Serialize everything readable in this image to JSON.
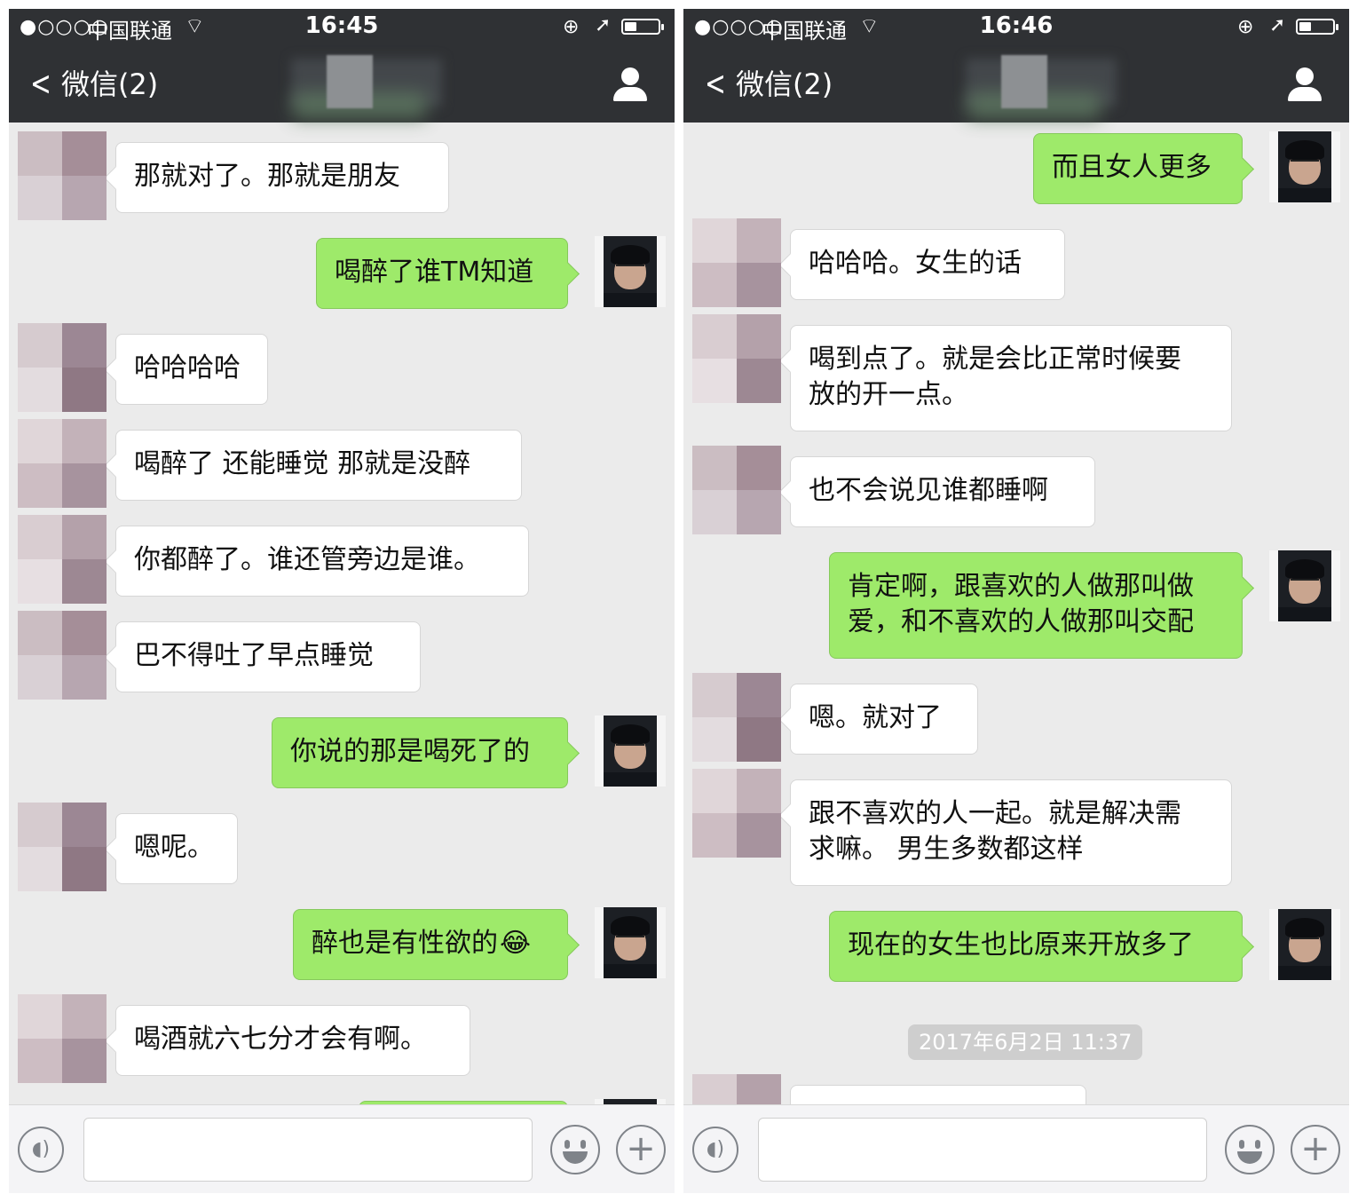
{
  "screens": [
    {
      "status": {
        "signal": "●○○○○",
        "carrier": "中国联通",
        "time": "16:45"
      },
      "nav": {
        "back_label": "微信(2)"
      },
      "timestamp": "",
      "messages": [
        {
          "from": "other",
          "text": "那就对了。那就是朋友"
        },
        {
          "from": "me",
          "text": "喝醉了谁TM知道"
        },
        {
          "from": "other",
          "text": "哈哈哈哈"
        },
        {
          "from": "other",
          "text": "喝醉了 还能睡觉 那就是没醉"
        },
        {
          "from": "other",
          "text": "你都醉了。谁还管旁边是谁。"
        },
        {
          "from": "other",
          "text": "巴不得吐了早点睡觉"
        },
        {
          "from": "me",
          "text": "你说的那是喝死了的"
        },
        {
          "from": "other",
          "text": "嗯呢。"
        },
        {
          "from": "me",
          "text": "醉也是有性欲的",
          "emoji": "😂"
        },
        {
          "from": "other",
          "text": "喝酒就六七分才会有啊。"
        },
        {
          "from": "me",
          "text": ""
        }
      ]
    },
    {
      "status": {
        "signal": "●○○○○",
        "carrier": "中国联通",
        "time": "16:46"
      },
      "nav": {
        "back_label": "微信(2)"
      },
      "timestamp": "2017年6月2日 11:37",
      "messages": [
        {
          "from": "me",
          "text": "而且女人更多"
        },
        {
          "from": "other",
          "text": "哈哈哈。女生的话"
        },
        {
          "from": "other",
          "text": "喝到点了。就是会比正常时候要\n放的开一点。"
        },
        {
          "from": "other",
          "text": "也不会说见谁都睡啊"
        },
        {
          "from": "me",
          "text": "肯定啊，跟喜欢的人做那叫做\n爱，和不喜欢的人做那叫交配"
        },
        {
          "from": "other",
          "text": "嗯。就对了"
        },
        {
          "from": "other",
          "text": "跟不喜欢的人一起。就是解决需\n求嘛。 男生多数都这样"
        },
        {
          "from": "me",
          "text": "现在的女生也比原来开放多了"
        },
        {
          "from": "other",
          "text": ""
        }
      ]
    }
  ],
  "icons": {
    "back": "chevron-left-icon",
    "profile": "person-icon",
    "voice": "voice-icon",
    "emoji": "smiley-icon",
    "plus": "plus-icon",
    "wifi": "wifi-icon",
    "battery": "battery-icon",
    "location": "location-arrow-icon",
    "rotation_lock": "rotation-lock-icon"
  },
  "battery_level": 0.35,
  "colors": {
    "nav_bg": "#2f3134",
    "chat_bg": "#ebebeb",
    "bubble_out": "#9eea6a",
    "bubble_in": "#ffffff",
    "timestamp_bg": "#cecece"
  }
}
